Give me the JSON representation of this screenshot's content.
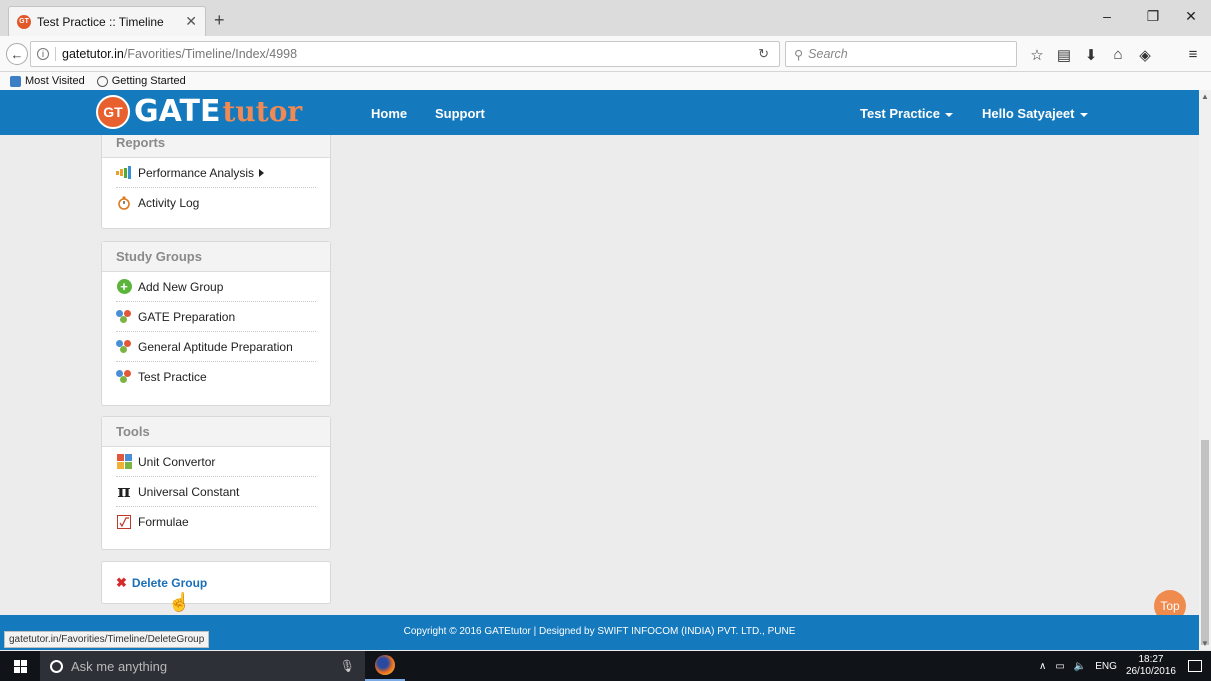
{
  "browser": {
    "tab_title": "Test Practice :: Timeline",
    "tab_favicon": "GT",
    "url_host": "gatetutor.in",
    "url_path": "/Favorities/Timeline/Index/4998",
    "search_placeholder": "Search",
    "bookmarks": [
      "Most Visited",
      "Getting Started"
    ],
    "status_url": "gatetutor.in/Favorities/Timeline/DeleteGroup"
  },
  "header": {
    "logo_badge": "GT",
    "logo_gate": "GATE",
    "logo_tutor": "tutor",
    "nav": {
      "home": "Home",
      "support": "Support",
      "test_practice": "Test Practice",
      "user": "Hello Satyajeet"
    },
    "brand_color": "#1479bd",
    "accent_color": "#f08a55"
  },
  "sidebar": {
    "reports": {
      "title": "Reports",
      "items": [
        {
          "label": "Performance Analysis",
          "icon": "bar-chart-icon"
        },
        {
          "label": "Activity Log",
          "icon": "stopwatch-icon"
        }
      ]
    },
    "study_groups": {
      "title": "Study Groups",
      "items": [
        {
          "label": "Add New Group",
          "icon": "plus-circle-icon"
        },
        {
          "label": "GATE Preparation",
          "icon": "group-icon"
        },
        {
          "label": "General Aptitude Preparation",
          "icon": "group-icon"
        },
        {
          "label": "Test Practice",
          "icon": "group-icon"
        }
      ]
    },
    "tools": {
      "title": "Tools",
      "items": [
        {
          "label": "Unit Convertor",
          "icon": "unit-convertor-icon"
        },
        {
          "label": "Universal Constant",
          "icon": "pi-icon"
        },
        {
          "label": "Formulae",
          "icon": "formula-icon"
        }
      ]
    },
    "delete_group": "Delete Group"
  },
  "top_button": "Top",
  "footer": {
    "copyright": "Copyright © 2016 GATEtutor | Designed by SWIFT INFOCOM (INDIA) PVT. LTD., PUNE"
  },
  "taskbar": {
    "search_placeholder": "Ask me anything",
    "language": "ENG",
    "time": "18:27",
    "date": "26/10/2016"
  }
}
